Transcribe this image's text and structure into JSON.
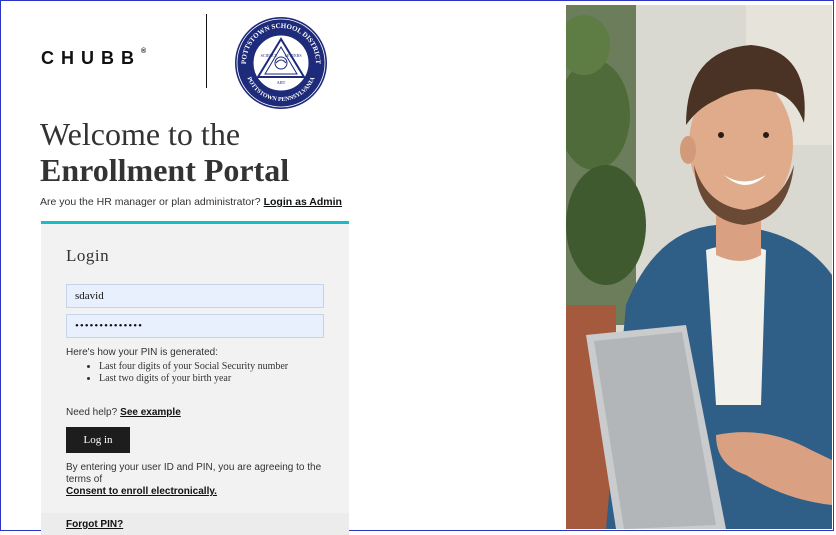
{
  "brand": {
    "logo_text": "CHUBB",
    "logo_mark": "®",
    "seal_top_text": "POTTSTOWN SCHOOL DISTRICT",
    "seal_bottom_text": "POTTSTOWN PENNSYLVANIA",
    "seal_center_words": [
      "SCIENCE",
      "LETTERS",
      "ART"
    ]
  },
  "header": {
    "title_line1": "Welcome to the",
    "title_line2": "Enrollment Portal"
  },
  "admin": {
    "prompt": "Are you the HR manager or plan administrator?",
    "link": "Login as Admin"
  },
  "login": {
    "title": "Login",
    "user_id_value": "sdavid",
    "pin_value": "••••••••••••••",
    "pin_note": "Here's how your PIN is generated:",
    "pin_rules": [
      "Last four digits of your Social Security number",
      "Last two digits of your birth year"
    ],
    "help_prompt": "Need help?",
    "help_link": "See example",
    "submit_label": "Log in",
    "consent_text": "By entering your user ID and PIN, you are agreeing to the terms of",
    "consent_link": "Consent to enroll electronically.",
    "forgot_link": "Forgot PIN?"
  },
  "colors": {
    "accent": "#18bdc4",
    "button_bg": "#1d1d1d",
    "input_bg": "#e8f0fe",
    "seal_blue": "#1e2a7a",
    "frame": "#2b36c7"
  }
}
